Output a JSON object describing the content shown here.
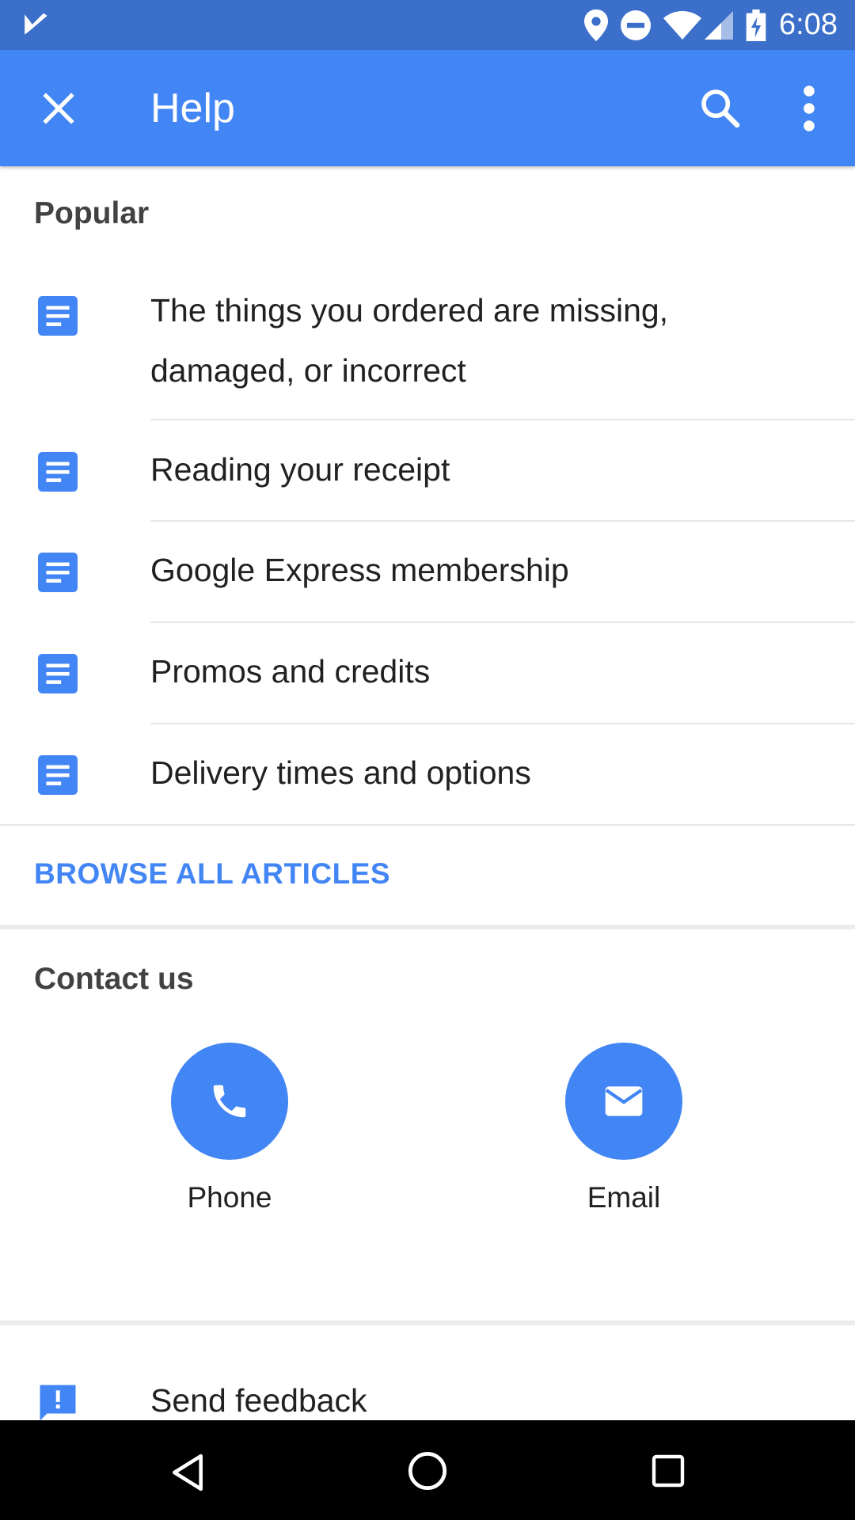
{
  "status_bar": {
    "time": "6:08",
    "icons": [
      "notification-check-icon",
      "location-icon",
      "do-not-disturb-icon",
      "wifi-icon",
      "signal-icon",
      "battery-charging-icon"
    ]
  },
  "app_bar": {
    "title": "Help",
    "icons": [
      "close-icon",
      "search-icon",
      "more-vert-icon"
    ]
  },
  "popular": {
    "heading": "Popular",
    "articles": [
      {
        "label": "The things you ordered are missing, damaged, or incorrect",
        "icon": "article-icon"
      },
      {
        "label": "Reading your receipt",
        "icon": "article-icon"
      },
      {
        "label": "Google Express membership",
        "icon": "article-icon"
      },
      {
        "label": "Promos and credits",
        "icon": "article-icon"
      },
      {
        "label": "Delivery times and options",
        "icon": "article-icon"
      }
    ],
    "browse_label": "BROWSE ALL ARTICLES"
  },
  "contact": {
    "heading": "Contact us",
    "options": [
      {
        "label": "Phone",
        "icon": "phone-icon"
      },
      {
        "label": "Email",
        "icon": "email-icon"
      }
    ]
  },
  "feedback": {
    "label": "Send feedback",
    "icon": "feedback-icon"
  },
  "colors": {
    "status_bar": "#3b6fca",
    "app_bar": "#4285f4",
    "accent": "#4285f4",
    "nav_bar": "#000000"
  },
  "nav_bar": {
    "icons": [
      "back-icon",
      "home-icon",
      "recents-icon"
    ]
  }
}
